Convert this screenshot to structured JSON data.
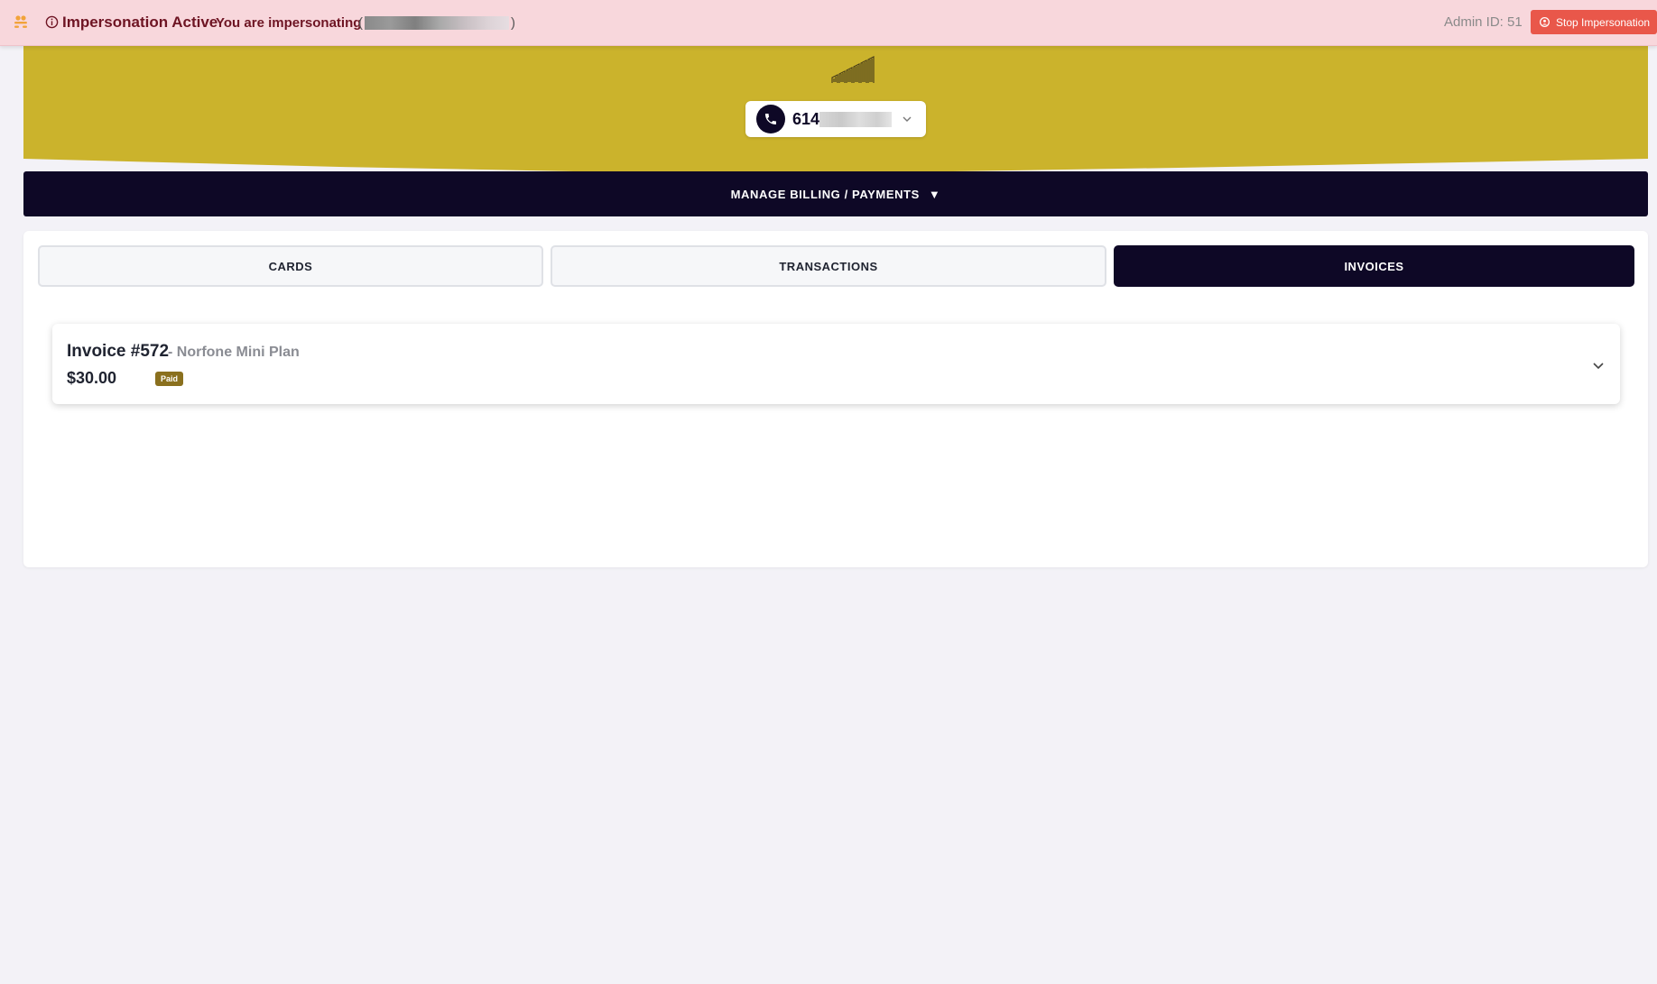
{
  "impersonation": {
    "title": "Impersonation Active",
    "message": "You are impersonating",
    "name_open": "(",
    "name_close": ")",
    "admin_id": "Admin ID: 51",
    "stop_label": "Stop Impersonation",
    "icons": [
      "app-icon",
      "info-icon",
      "stop-icon"
    ]
  },
  "header": {
    "phone_prefix": "614",
    "brand_color": "#cbb32c",
    "icons": [
      "logo-icon",
      "phone-icon",
      "chevron-down-icon"
    ]
  },
  "billing": {
    "label": "MANAGE BILLING / PAYMENTS",
    "caret": "▼"
  },
  "tabs": [
    {
      "label": "CARDS",
      "active": false
    },
    {
      "label": "TRANSACTIONS",
      "active": false
    },
    {
      "label": "INVOICES",
      "active": true
    }
  ],
  "invoices": [
    {
      "title": "Invoice #572",
      "plan": "- Norfone Mini Plan",
      "amount": "$30.00",
      "status": "Paid",
      "status_color": "#8a701e"
    }
  ],
  "colors": {
    "navy": "#0e0826",
    "banner_bg": "#f8d7dc",
    "stop_button": "#e9574a",
    "page_bg": "#f3f2f7"
  }
}
